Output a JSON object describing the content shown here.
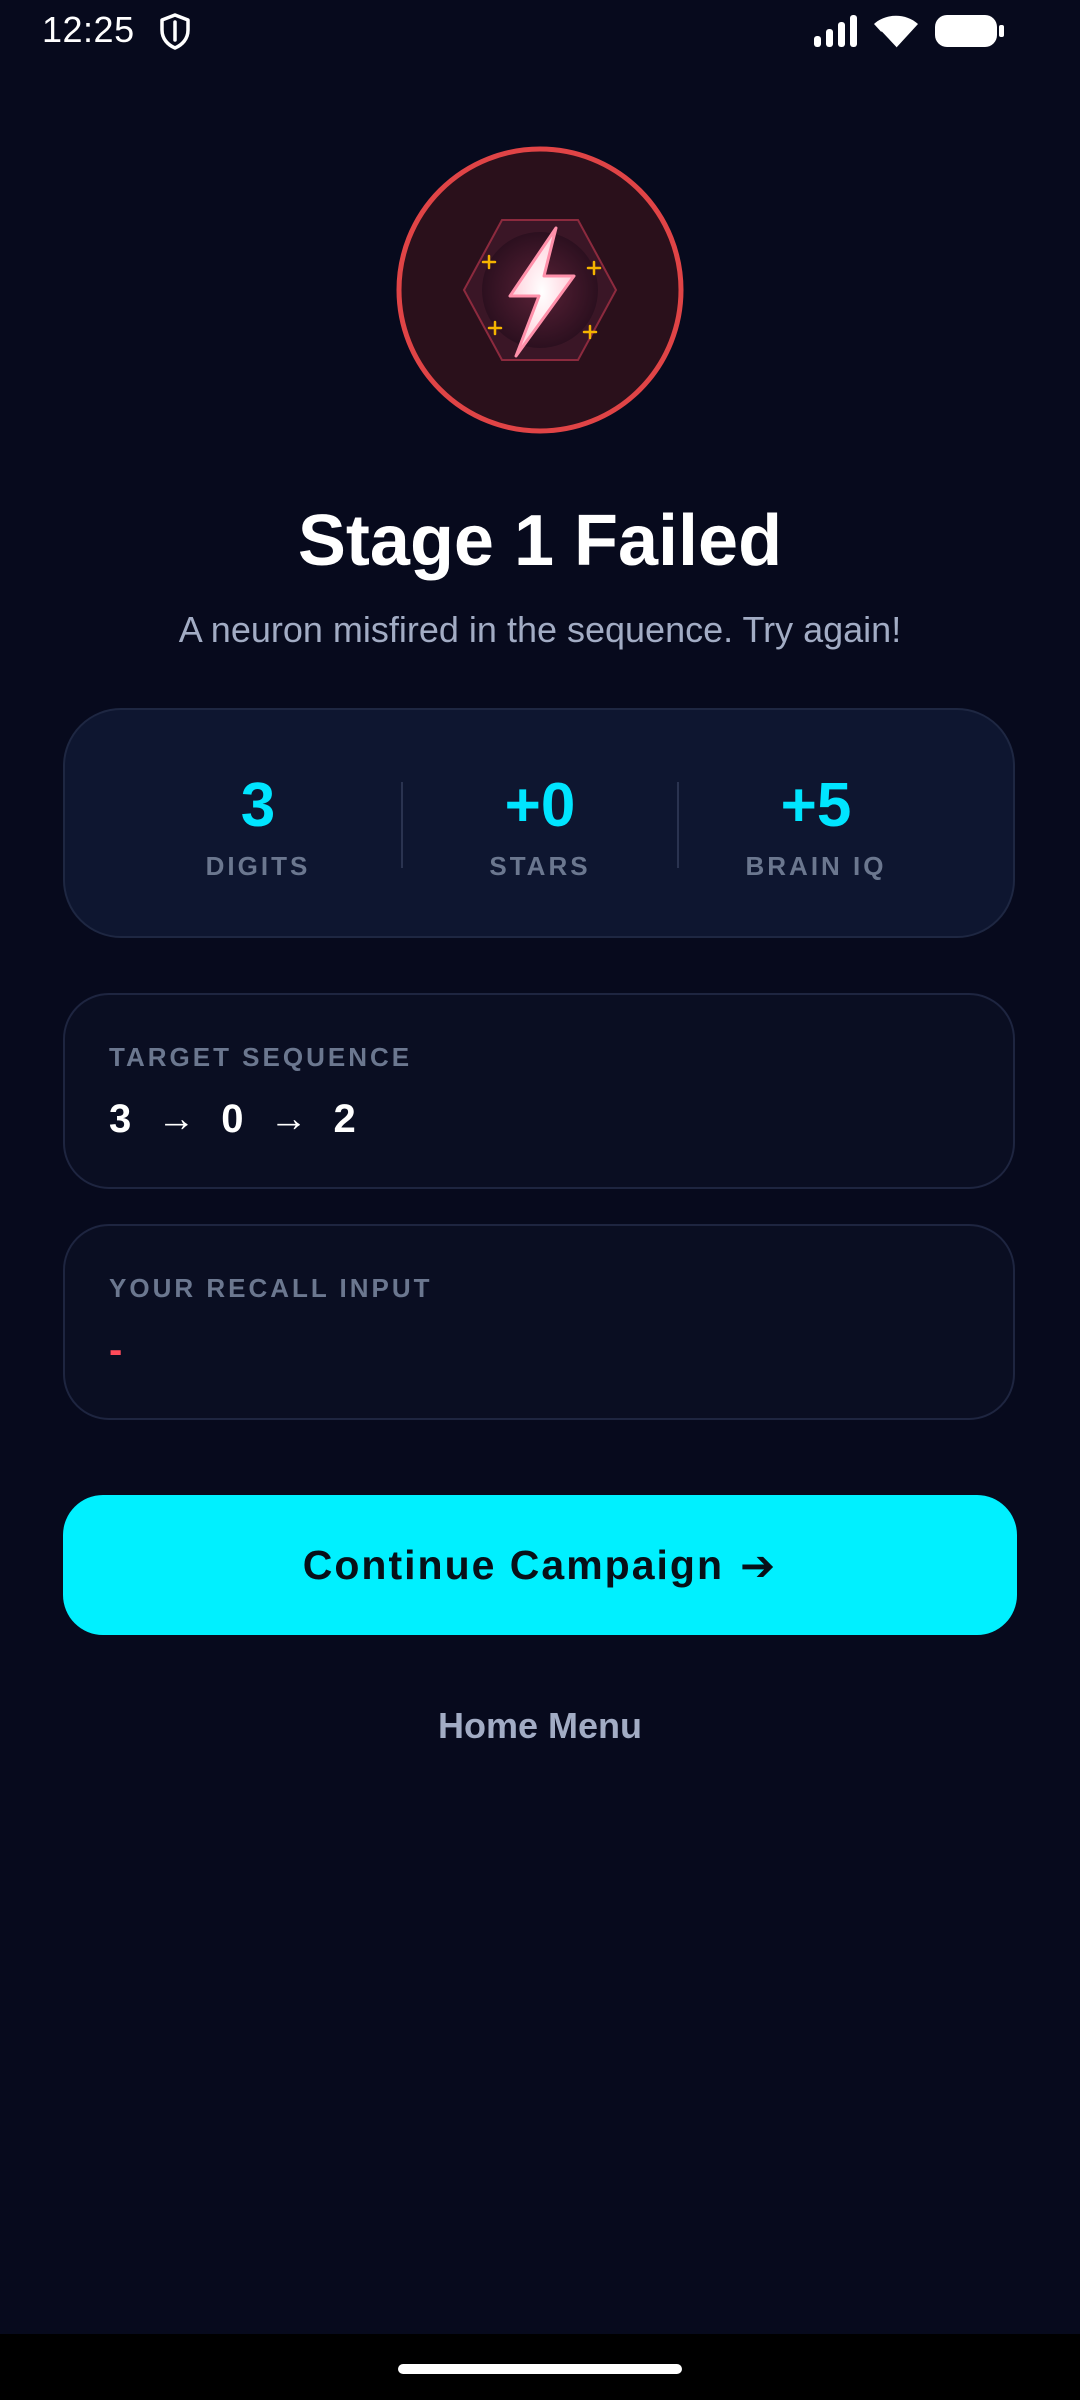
{
  "status_bar": {
    "time": "12:25",
    "icons": [
      "shield-icon",
      "signal-icon",
      "wifi-icon",
      "battery-icon"
    ]
  },
  "hero": {
    "icon": "lightning-bolt-icon",
    "ring_color": "#e04446",
    "sparkle_color": "#f5b400"
  },
  "result": {
    "title": "Stage 1 Failed",
    "subtitle": "A neuron misfired in the sequence. Try again!"
  },
  "stats": [
    {
      "value": "3",
      "label": "DIGITS"
    },
    {
      "value": "+0",
      "label": "STARS"
    },
    {
      "value": "+5",
      "label": "BRAIN IQ"
    }
  ],
  "target_sequence": {
    "label": "TARGET SEQUENCE",
    "digits": [
      "3",
      "0",
      "2"
    ],
    "separator": "→"
  },
  "recall_input": {
    "label": "YOUR RECALL INPUT",
    "value": "-"
  },
  "actions": {
    "continue_label": "Continue Campaign",
    "continue_arrow": "➔",
    "home_label": "Home Menu"
  },
  "colors": {
    "background": "#070a1d",
    "accent": "#00f0ff",
    "error": "#ff4b5a",
    "muted_text": "#a2acc4"
  }
}
